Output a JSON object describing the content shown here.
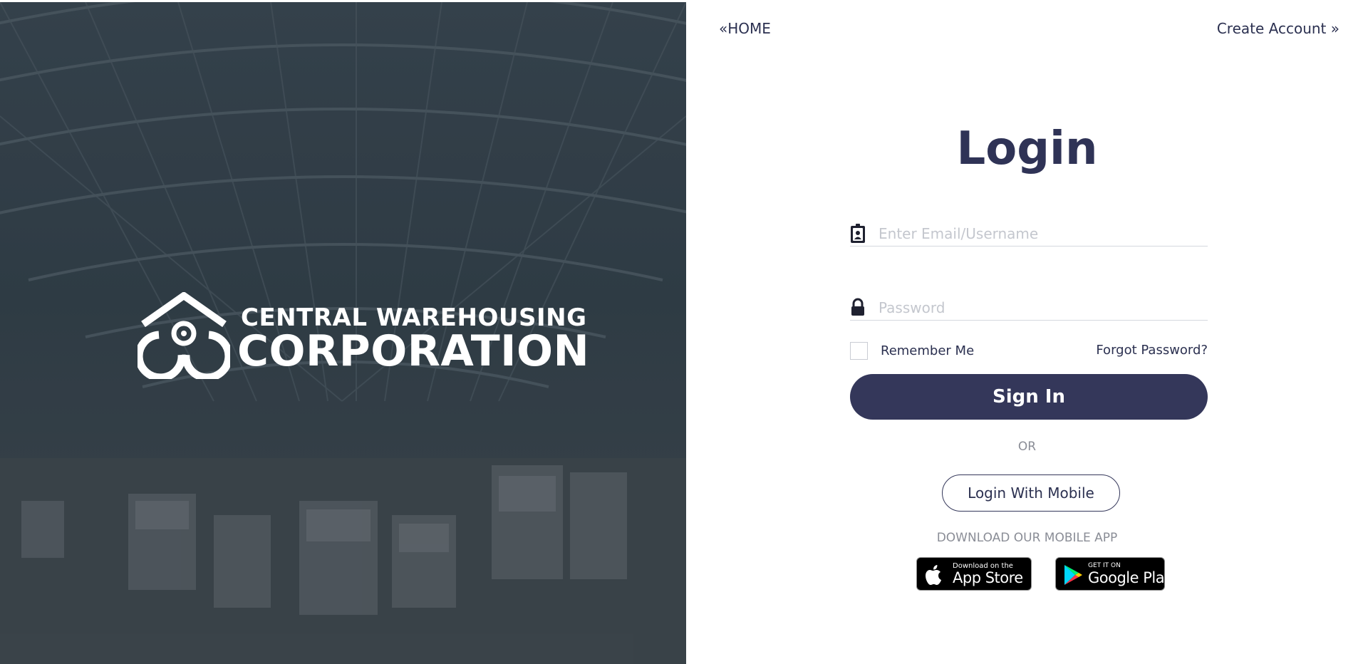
{
  "brand": {
    "line1": "CENTRAL WAREHOUSING",
    "line2": "CORPORATION"
  },
  "nav": {
    "home_label": "«HOME",
    "create_account_label": "Create Account »"
  },
  "login": {
    "title": "Login",
    "email_placeholder": "Enter Email/Username",
    "password_placeholder": "Password",
    "remember_label": "Remember Me",
    "forgot_label": "Forgot Password?",
    "signin_label": "Sign In",
    "or_label": "OR",
    "mobile_login_label": "Login With Mobile"
  },
  "download": {
    "heading": "DOWNLOAD OUR MOBILE APP",
    "appstore_small": "Download on the",
    "appstore_big": "App Store",
    "googleplay_small": "GET IT ON",
    "googleplay_big": "Google Play"
  },
  "colors": {
    "primary": "#34375a",
    "heading": "#2f3356",
    "muted": "#8a8d96",
    "hero_bg": "#3a4752"
  }
}
